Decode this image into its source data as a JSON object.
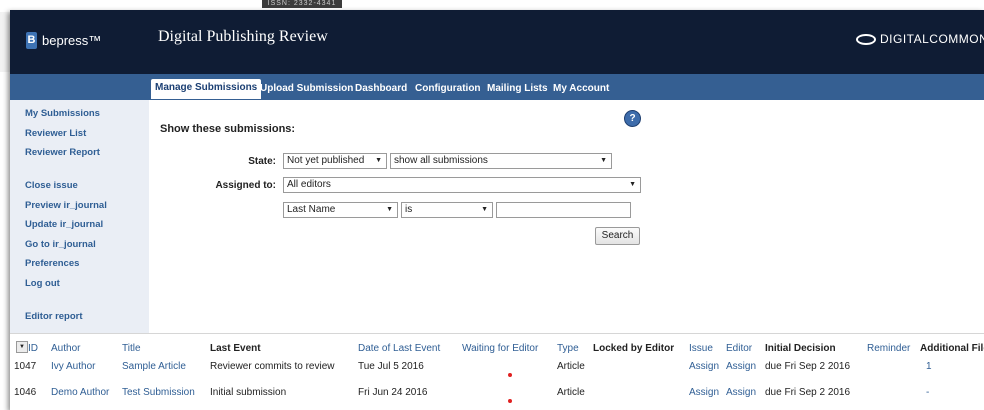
{
  "brand": {
    "logo_mark": "B",
    "logo_text": "bepress™",
    "dc_text": "DIGITALCOMMONS"
  },
  "background": {
    "scrap_text": "ISSN: 2332-4341"
  },
  "app_title": "Digital Publishing Review",
  "nav": {
    "tabs": [
      "Manage Submissions",
      "Upload Submission",
      "Dashboard",
      "Configuration",
      "Mailing Lists",
      "My Account"
    ],
    "active": "Manage Submissions"
  },
  "sidebar": {
    "group1": [
      "My Submissions",
      "Reviewer List",
      "Reviewer Report"
    ],
    "group2": [
      "Close issue",
      "Preview ir_journal",
      "Update ir_journal",
      "Go to ir_journal",
      "Preferences",
      "Log out"
    ],
    "group3": [
      "Editor report"
    ]
  },
  "help_icon": "?",
  "filter": {
    "heading": "Show these submissions:",
    "state_label": "State:",
    "state_value": "Not yet published",
    "scope_value": "show all submissions",
    "assigned_label": "Assigned to:",
    "assigned_value": "All editors",
    "field_value": "Last Name",
    "operator_value": "is",
    "text_value": "",
    "search_label": "Search"
  },
  "table": {
    "headers": [
      "ID",
      "Author",
      "Title",
      "Last Event",
      "Date of Last Event",
      "Waiting for Editor",
      "Type",
      "Locked by Editor",
      "Issue",
      "Editor",
      "Initial Decision",
      "Reminder",
      "Additional Files"
    ],
    "rows": [
      {
        "id": "1047",
        "author": "Ivy Author",
        "title": "Sample Article",
        "last_event": "Reviewer commits to review",
        "date": "Tue Jul 5 2016",
        "type": "Article",
        "issue": "Assign",
        "editor": "Assign",
        "decision": "due Fri Sep 2 2016",
        "files": "1"
      },
      {
        "id": "1046",
        "author": "Demo Author",
        "title": "Test Submission",
        "last_event": "Initial submission",
        "date": "Fri Jun 24 2016",
        "type": "Article",
        "issue": "Assign",
        "editor": "Assign",
        "decision": "due Fri Sep 2 2016",
        "files": "-"
      }
    ]
  },
  "colors": {
    "header_bg": "#0f1c34",
    "nav_bg": "#355f92",
    "link": "#2f5e94",
    "sidebar_bg": "#eaeef5",
    "waiting_dot": "#e02020"
  }
}
